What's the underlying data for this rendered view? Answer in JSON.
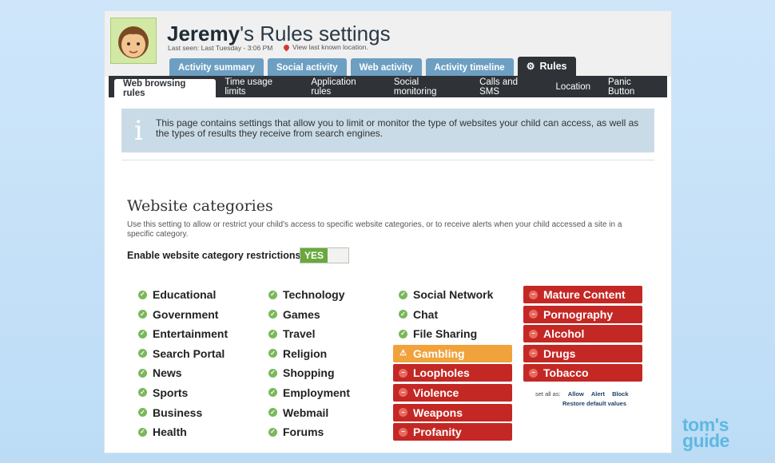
{
  "header": {
    "user_name": "Jeremy",
    "title_suffix": "'s Rules settings",
    "last_seen": "Last seen: Last Tuesday - 3:06 PM",
    "view_location": "View last known location."
  },
  "main_tabs": [
    {
      "label": "Activity summary"
    },
    {
      "label": "Social activity"
    },
    {
      "label": "Web activity"
    },
    {
      "label": "Activity timeline"
    },
    {
      "label": "Rules",
      "icon": "gear-icon"
    }
  ],
  "sub_tabs": [
    {
      "label": "Web browsing rules"
    },
    {
      "label": "Time usage limits"
    },
    {
      "label": "Application rules"
    },
    {
      "label": "Social monitoring"
    },
    {
      "label": "Calls and SMS"
    },
    {
      "label": "Location"
    },
    {
      "label": "Panic Button"
    }
  ],
  "info": {
    "icon": "i",
    "text": "This page contains settings that allow you to limit or monitor the type of websites your child can access, as well as the types of results they receive from search engines."
  },
  "categories_section": {
    "title": "Website categories",
    "description": "Use this setting to allow or restrict your child's access to specific website categories, or to receive alerts when your child accessed a site in a specific category.",
    "enable_label": "Enable website category restrictions",
    "toggle_value": "YES"
  },
  "columns": [
    [
      {
        "label": "Educational",
        "status": "allow"
      },
      {
        "label": "Government",
        "status": "allow"
      },
      {
        "label": "Entertainment",
        "status": "allow"
      },
      {
        "label": "Search Portal",
        "status": "allow"
      },
      {
        "label": "News",
        "status": "allow"
      },
      {
        "label": "Sports",
        "status": "allow"
      },
      {
        "label": "Business",
        "status": "allow"
      },
      {
        "label": "Health",
        "status": "allow"
      }
    ],
    [
      {
        "label": "Technology",
        "status": "allow"
      },
      {
        "label": "Games",
        "status": "allow"
      },
      {
        "label": "Travel",
        "status": "allow"
      },
      {
        "label": "Religion",
        "status": "allow"
      },
      {
        "label": "Shopping",
        "status": "allow"
      },
      {
        "label": "Employment",
        "status": "allow"
      },
      {
        "label": "Webmail",
        "status": "allow"
      },
      {
        "label": "Forums",
        "status": "allow"
      }
    ],
    [
      {
        "label": "Social Network",
        "status": "allow"
      },
      {
        "label": "Chat",
        "status": "allow"
      },
      {
        "label": "File Sharing",
        "status": "allow"
      },
      {
        "label": "Gambling",
        "status": "alert"
      },
      {
        "label": "Loopholes",
        "status": "block"
      },
      {
        "label": "Violence",
        "status": "block"
      },
      {
        "label": "Weapons",
        "status": "block"
      },
      {
        "label": "Profanity",
        "status": "block"
      }
    ],
    [
      {
        "label": "Mature Content",
        "status": "block"
      },
      {
        "label": "Pornography",
        "status": "block"
      },
      {
        "label": "Alcohol",
        "status": "block"
      },
      {
        "label": "Drugs",
        "status": "block"
      },
      {
        "label": "Tobacco",
        "status": "block"
      }
    ]
  ],
  "set_all": {
    "label": "set all as:",
    "allow": "Allow",
    "alert": "Alert",
    "block": "Block",
    "restore": "Restore default values"
  },
  "watermark": {
    "line1": "tom's",
    "line2": "guide"
  },
  "colors": {
    "allow": "#7ab85a",
    "alert": "#f0a23b",
    "block": "#c42824",
    "nav_dark": "#2f3338",
    "tab_blue": "#6c9fc2",
    "toggle_green": "#6aa83e"
  }
}
